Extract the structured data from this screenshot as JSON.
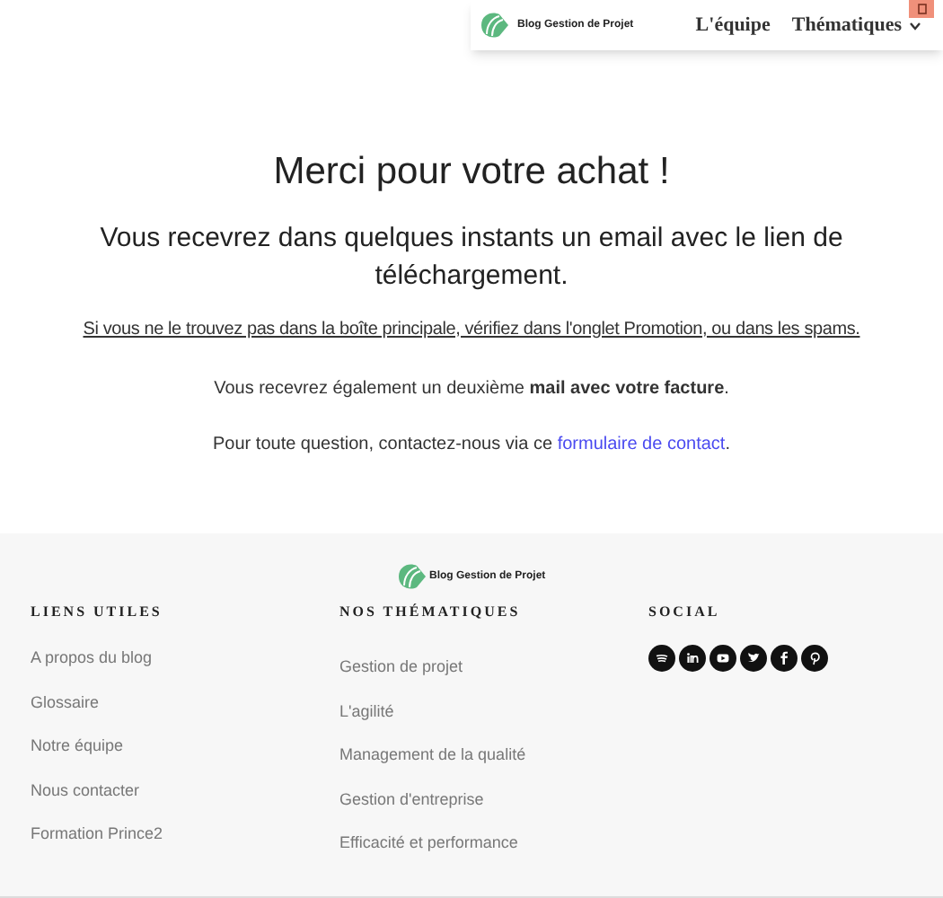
{
  "header": {
    "logo_text": "Blog Gestion de Projet",
    "nav": [
      {
        "label": "L'équipe",
        "dropdown": false
      },
      {
        "label": "Thématiques",
        "dropdown": true
      }
    ]
  },
  "main": {
    "title": "Merci pour votre achat !",
    "subtitle": "Vous recevrez dans quelques instants un email avec le lien de téléchargement.",
    "notice": "Si vous ne le trouvez pas dans la boîte principale, vérifiez dans l'onglet Promotion, ou dans les spams.",
    "invoice": "Vous recevrez également un deuxième **mail avec votre facture**.",
    "contact": {
      "text": "Pour toute question, contactez-nous via ce",
      "link": "formulaire de contact",
      "end": "."
    }
  },
  "footer": {
    "logo_text": "Blog Gestion de Projet",
    "columns": [
      {
        "heading": "LIENS UTILES",
        "kind": "links",
        "links": [
          "A propos du blog",
          "Glossaire",
          "Notre équipe",
          "Nous contacter",
          "Formation Prince2"
        ]
      },
      {
        "heading": "NOS THÉMATIQUES",
        "kind": "links",
        "links": [
          "Gestion de projet",
          "L'agilité",
          "Management de la qualité",
          "Gestion d'entreprise",
          "Efficacité et performance"
        ]
      },
      {
        "heading": "SOCIAL",
        "kind": "social"
      }
    ]
  }
}
